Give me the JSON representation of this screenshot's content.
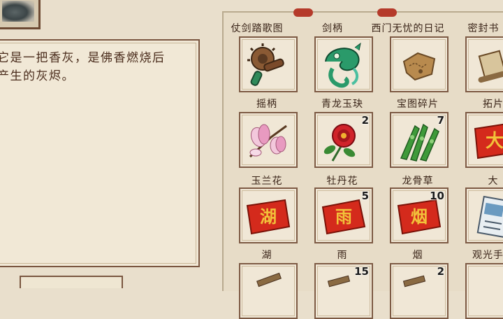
{
  "description": {
    "text": "它是一把香灰，是佛香燃烧后\n产生的灰烬。"
  },
  "inventory": {
    "header_labels": [
      "仗剑踏歌图",
      "剑柄",
      "西门无忧的日记",
      "密封书"
    ],
    "rows": [
      [
        {
          "label": "摇柄",
          "icon": "crank-icon",
          "count": ""
        },
        {
          "label": "青龙玉玦",
          "icon": "jade-dragon-icon",
          "count": ""
        },
        {
          "label": "宝图碎片",
          "icon": "map-fragment-icon",
          "count": ""
        },
        {
          "label": "拓片",
          "icon": "scroll-icon",
          "count": ""
        }
      ],
      [
        {
          "label": "玉兰花",
          "icon": "magnolia-icon",
          "count": ""
        },
        {
          "label": "牡丹花",
          "icon": "peony-icon",
          "count": "2"
        },
        {
          "label": "龙骨草",
          "icon": "herb-icon",
          "count": "7"
        },
        {
          "label": "大",
          "icon": "red-card-icon",
          "count": "",
          "glyph": "大"
        }
      ],
      [
        {
          "label": "湖",
          "icon": "red-card-icon",
          "count": "",
          "glyph": "湖"
        },
        {
          "label": "雨",
          "icon": "red-card-icon",
          "count": "5",
          "glyph": "雨"
        },
        {
          "label": "烟",
          "icon": "red-card-icon",
          "count": "10",
          "glyph": "烟"
        },
        {
          "label": "观光手册",
          "icon": "brochure-icon",
          "count": ""
        }
      ],
      [
        {
          "label": "",
          "icon": "wood-icon",
          "count": ""
        },
        {
          "label": "",
          "icon": "item-icon",
          "count": "15"
        },
        {
          "label": "",
          "icon": "item-icon",
          "count": "2"
        },
        {
          "label": "",
          "icon": "item-icon",
          "count": ""
        }
      ]
    ]
  },
  "colors": {
    "accent_red": "#c8261b",
    "frame_brown": "#7d5a44",
    "paper": "#f0e7d6"
  }
}
